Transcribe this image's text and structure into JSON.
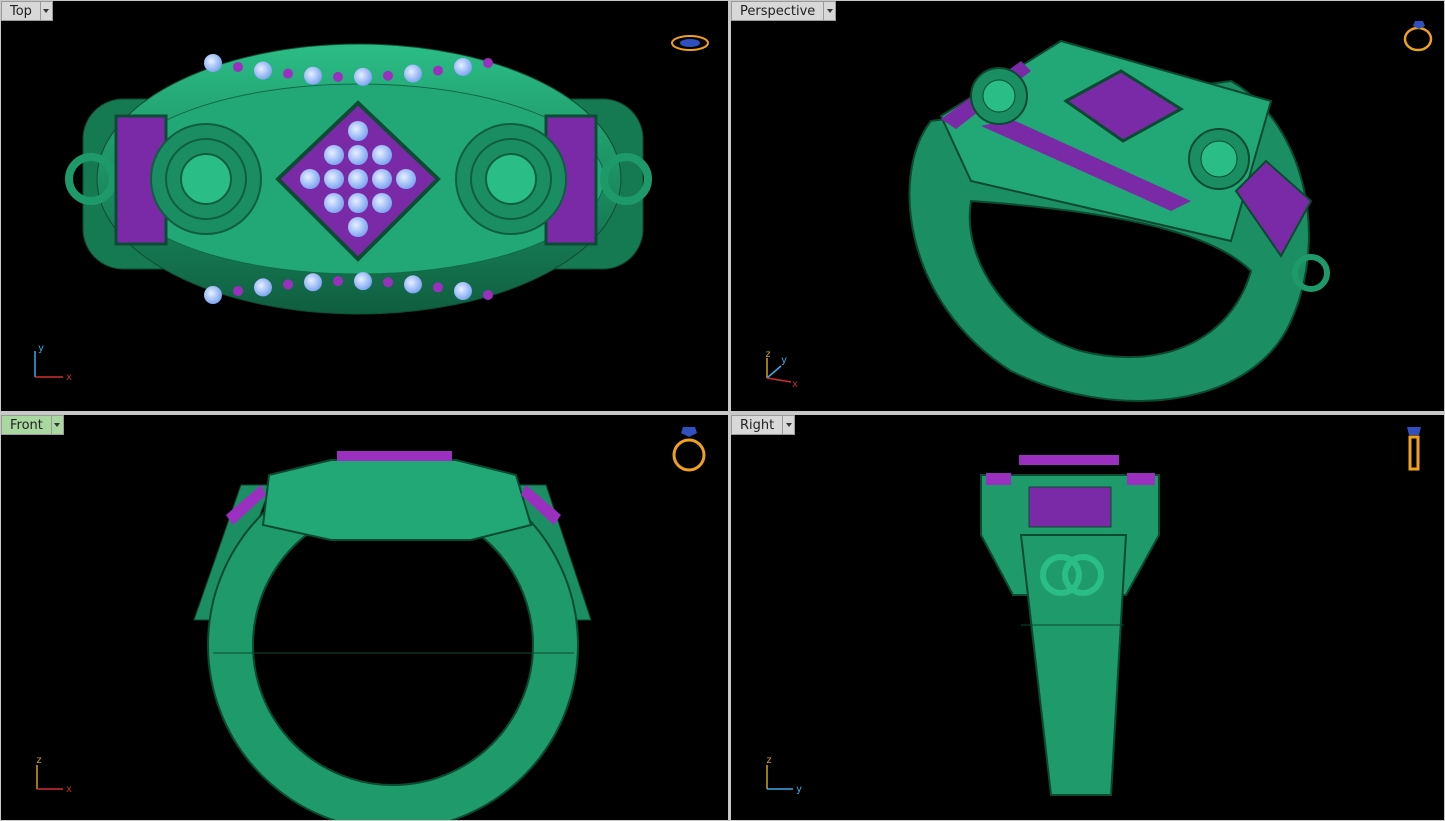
{
  "viewports": {
    "top": {
      "label": "Top",
      "axis_h": "x",
      "axis_v": "y"
    },
    "perspective": {
      "label": "Perspective",
      "axis_h": "x",
      "axis_v": "y",
      "axis_z": "z"
    },
    "front": {
      "label": "Front",
      "axis_h": "x",
      "axis_v": "z"
    },
    "right": {
      "label": "Right",
      "axis_h": "y",
      "axis_v": "z"
    }
  },
  "active_viewport": "front",
  "colors": {
    "viewport_bg": "#000000",
    "ring_metal": "#1f9a6a",
    "ring_edge": "#0f5e3e",
    "gem_purple": "#9b2fc0",
    "gem_light": "#a9c6ff",
    "axis_x": "#d03030",
    "axis_y": "#3fa8e0",
    "axis_z": "#d0a020",
    "orient_icon": "#f0a020",
    "tab_bg": "#d8d8d8",
    "tab_active_bg": "#a9d8a0"
  },
  "icons": {
    "top": "ring-top-orientation-icon",
    "perspective": "ring-perspective-orientation-icon",
    "front": "ring-front-orientation-icon",
    "right": "ring-side-orientation-icon"
  }
}
